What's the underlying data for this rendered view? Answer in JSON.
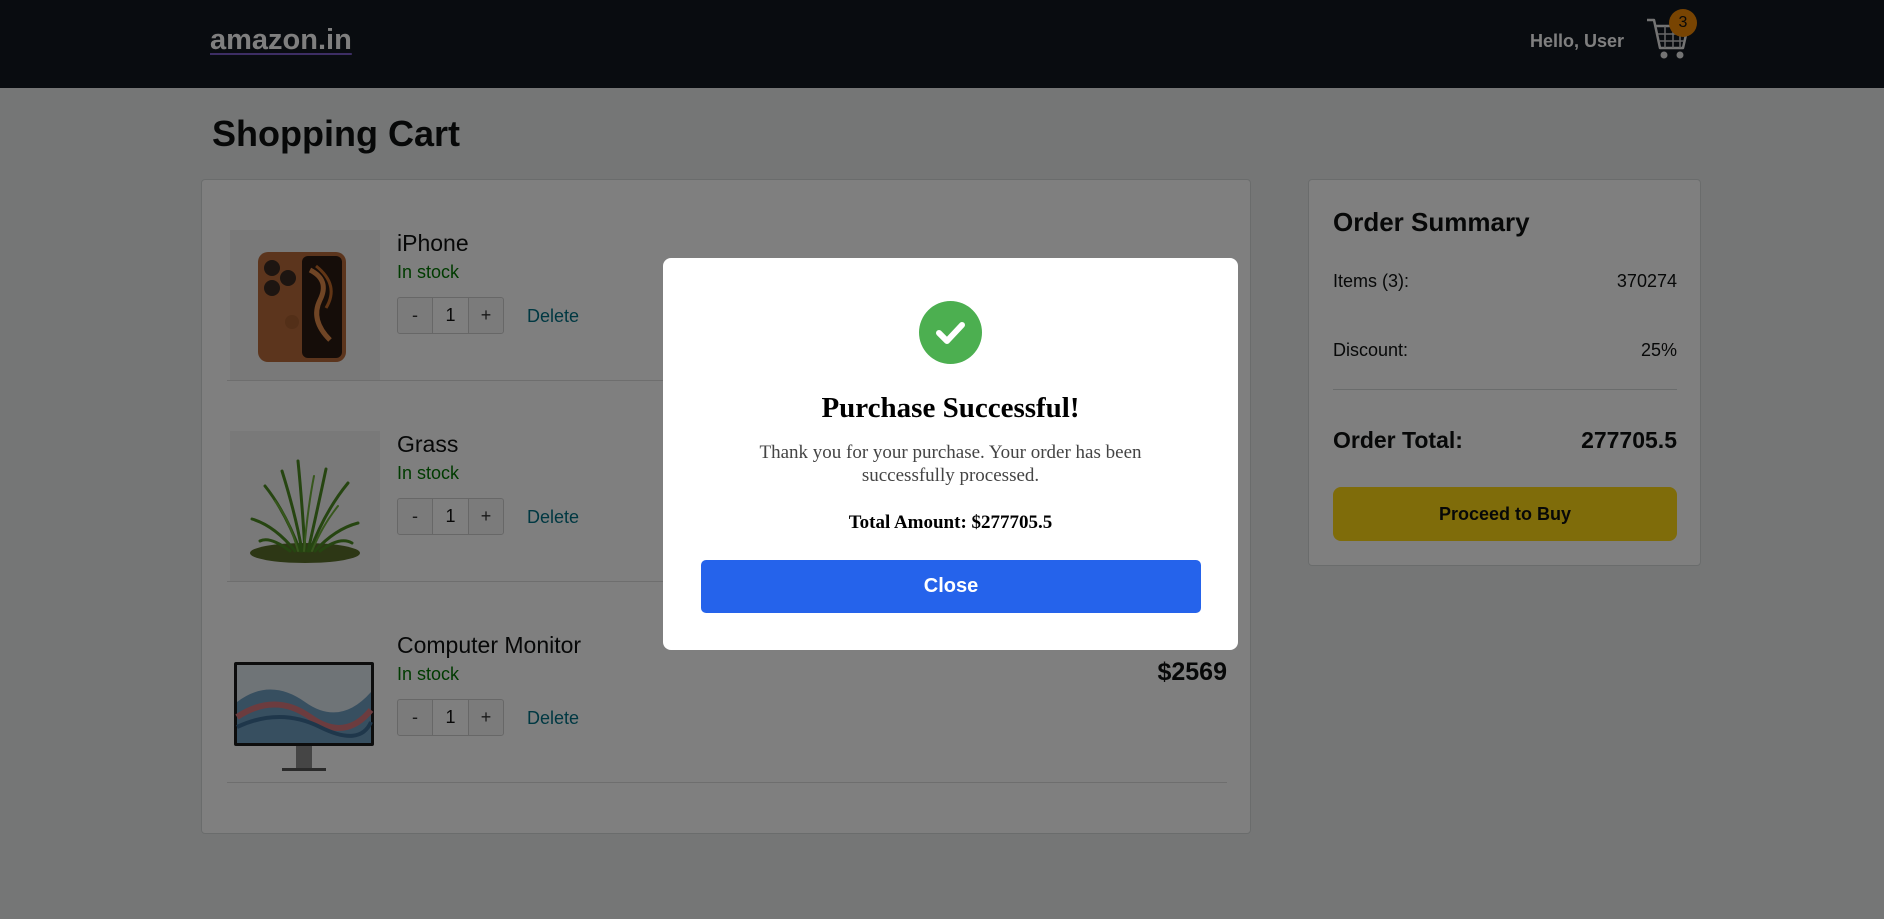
{
  "header": {
    "logo": "amazon.in",
    "greeting": "Hello, User",
    "cart_icon": "shopping-cart-icon",
    "cart_count": "3"
  },
  "page": {
    "title": "Shopping Cart"
  },
  "cart": {
    "items": [
      {
        "name": "iPhone",
        "stock": "In stock",
        "quantity": "1",
        "decrement": "-",
        "increment": "+",
        "delete": "Delete",
        "price": "",
        "image": "orange-smartphone-image"
      },
      {
        "name": "Grass",
        "stock": "In stock",
        "quantity": "1",
        "decrement": "-",
        "increment": "+",
        "delete": "Delete",
        "price": "",
        "image": "grass-tuft-image"
      },
      {
        "name": "Computer Monitor",
        "stock": "In stock",
        "quantity": "1",
        "decrement": "-",
        "increment": "+",
        "delete": "Delete",
        "price": "$2569",
        "image": "monitor-image"
      }
    ]
  },
  "summary": {
    "title": "Order Summary",
    "items_label": "Items (3):",
    "items_value": "370274",
    "discount_label": "Discount:",
    "discount_value": "25%",
    "total_label": "Order Total:",
    "total_value": "277705.5",
    "buy_button": "Proceed to Buy"
  },
  "modal": {
    "icon": "check-circle-icon",
    "title": "Purchase Successful!",
    "message": "Thank you for your purchase. Your order has been successfully processed.",
    "total": "Total Amount: $277705.5",
    "close_button": "Close"
  },
  "colors": {
    "header_bg": "#131921",
    "badge": "#f08804",
    "in_stock": "#007600",
    "link": "#007185",
    "buy_button": "#ffd814",
    "success": "#4caf50",
    "close_button": "#2563eb"
  }
}
